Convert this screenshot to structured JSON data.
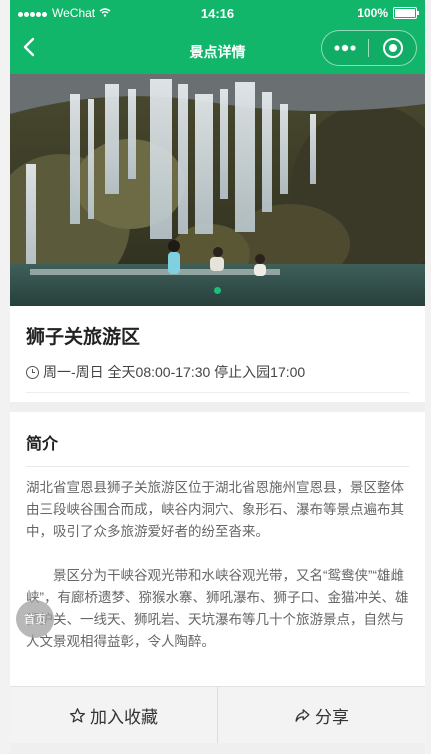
{
  "status_bar": {
    "carrier": "WeChat",
    "time": "14:16",
    "battery": "100%"
  },
  "nav": {
    "title": "景点详情",
    "back_icon": "chevron-left-icon",
    "menu_icon": "more-dots-icon",
    "close_icon": "target-icon"
  },
  "spot": {
    "name": "狮子关旅游区",
    "hours": "周一-周日 全天08:00-17:30 停止入园17:00"
  },
  "intro": {
    "heading": "简介",
    "paragraphs": [
      "湖北省宣恩县狮子关旅游区位于湖北省恩施州宣恩县，景区整体由三段峡谷围合而成，峡谷内洞穴、象形石、瀑布等景点遍布其中，吸引了众多旅游爱好者的纷至沓来。",
      "景区分为干峡谷观光带和水峡谷观光带，又名“鸳鸯侠”“雄雌峡”，有廊桥遗梦、猕猴水寨、狮吼瀑布、狮子口、金猫冲关、雄狮护关、一线天、狮吼岩、天坑瀑布等几十个旅游景点，自然与人文景观相得益彰，令人陶醉。"
    ]
  },
  "floating": {
    "label": "首页"
  },
  "actions": {
    "favorite": "加入收藏",
    "share": "分享"
  },
  "colors": {
    "brand": "#12b66b"
  }
}
